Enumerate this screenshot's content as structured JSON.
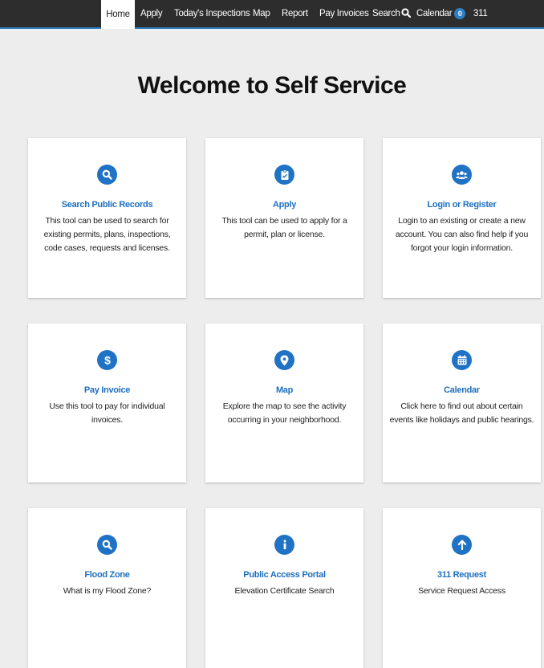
{
  "nav": {
    "items": [
      {
        "label": "Home",
        "active": true
      },
      {
        "label": "Apply"
      },
      {
        "label": "Today's Inspections"
      },
      {
        "label": "Map"
      },
      {
        "label": "Report"
      },
      {
        "label": "Pay Invoices"
      },
      {
        "label": "Search"
      },
      {
        "label": "Calendar",
        "badge": "0"
      },
      {
        "label": "311"
      }
    ]
  },
  "page": {
    "title": "Welcome to Self Service"
  },
  "cards": [
    {
      "icon": "search-icon",
      "title": "Search Public Records",
      "description": "This tool can be used to search for existing permits, plans, inspections, code cases, requests and licenses."
    },
    {
      "icon": "clipboard-check-icon",
      "title": "Apply",
      "description": "This tool can be used to apply for a permit, plan or license."
    },
    {
      "icon": "users-icon",
      "title": "Login or Register",
      "description": "Login to an existing or create a new account. You can also find help if you forgot your login information."
    },
    {
      "icon": "dollar-icon",
      "title": "Pay Invoice",
      "description": "Use this tool to pay for individual invoices."
    },
    {
      "icon": "map-marker-icon",
      "title": "Map",
      "description": "Explore the map to see the activity occurring in your neighborhood."
    },
    {
      "icon": "calendar-icon",
      "title": "Calendar",
      "description": "Click here to find out about certain events like holidays and public hearings."
    },
    {
      "icon": "search-icon",
      "title": "Flood Zone",
      "description": "What is my Flood Zone?"
    },
    {
      "icon": "info-icon",
      "title": "Public Access Portal",
      "description": "Elevation Certificate Search"
    },
    {
      "icon": "arrow-up-icon",
      "title": "311 Request",
      "description": "Service Request Access"
    }
  ],
  "colors": {
    "accent": "#1f72c4",
    "nav_bg": "#2d2d2d",
    "page_bg": "#ededed"
  }
}
